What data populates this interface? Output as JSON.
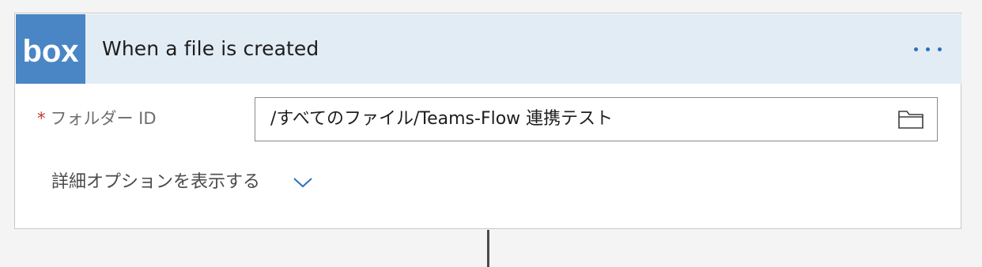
{
  "trigger": {
    "logo_text": "box",
    "title": "When a file is created",
    "menu_icon": "more-horizontal-icon",
    "accent_color": "#2c6fbe",
    "brand_color": "#4a86c5"
  },
  "folder_field": {
    "required_marker": "*",
    "label": "フォルダー ID",
    "value": "/すべてのファイル/Teams-Flow 連携テスト",
    "picker_icon": "folder-icon"
  },
  "advanced": {
    "label": "詳細オプションを表示する",
    "icon": "chevron-down-icon"
  }
}
